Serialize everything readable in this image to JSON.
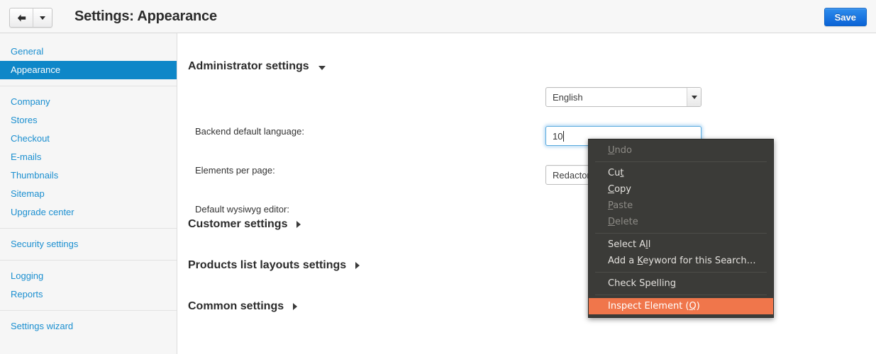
{
  "topbar": {
    "back_icon": "arrow-left-icon",
    "caret_icon": "chevron-down-icon",
    "title": "Settings: Appearance",
    "save_label": "Save",
    "save_color": "#0b63d6"
  },
  "sidebar": {
    "active_color": "#0e87c8",
    "link_color": "#1b8fd0",
    "groups": [
      {
        "items": [
          {
            "label": "General",
            "active": false
          },
          {
            "label": "Appearance",
            "active": true
          }
        ]
      },
      {
        "items": [
          {
            "label": "Company",
            "active": false
          },
          {
            "label": "Stores",
            "active": false
          },
          {
            "label": "Checkout",
            "active": false
          },
          {
            "label": "E-mails",
            "active": false
          },
          {
            "label": "Thumbnails",
            "active": false
          },
          {
            "label": "Sitemap",
            "active": false
          },
          {
            "label": "Upgrade center",
            "active": false
          }
        ]
      },
      {
        "items": [
          {
            "label": "Security settings",
            "active": false
          }
        ]
      },
      {
        "items": [
          {
            "label": "Logging",
            "active": false
          },
          {
            "label": "Reports",
            "active": false
          }
        ]
      },
      {
        "items": [
          {
            "label": "Settings wizard",
            "active": false
          }
        ]
      }
    ]
  },
  "main": {
    "sections": [
      {
        "title": "Administrator settings",
        "expanded": true,
        "icon": "triangle-down-icon"
      },
      {
        "title": "Customer settings",
        "expanded": false,
        "icon": "triangle-right-icon"
      },
      {
        "title": "Products list layouts settings",
        "expanded": false,
        "icon": "triangle-right-icon"
      },
      {
        "title": "Common settings",
        "expanded": false,
        "icon": "triangle-right-icon"
      }
    ],
    "fields": {
      "language": {
        "label": "Backend default language:",
        "value": "English"
      },
      "elements_per_page": {
        "label": "Elements per page:",
        "value": "10",
        "focused": true
      },
      "wysiwyg": {
        "label": "Default wysiwyg editor:",
        "value": "Redactor"
      }
    }
  },
  "context_menu": {
    "highlight_color": "#f0764b",
    "background_color": "#3b3b38",
    "groups": [
      {
        "items": [
          {
            "pre": "",
            "accel": "U",
            "post": "ndo",
            "disabled": true,
            "highlight": false
          }
        ]
      },
      {
        "items": [
          {
            "pre": "Cu",
            "accel": "t",
            "post": "",
            "disabled": false,
            "highlight": false
          },
          {
            "pre": "",
            "accel": "C",
            "post": "opy",
            "disabled": false,
            "highlight": false
          },
          {
            "pre": "",
            "accel": "P",
            "post": "aste",
            "disabled": true,
            "highlight": false
          },
          {
            "pre": "",
            "accel": "D",
            "post": "elete",
            "disabled": true,
            "highlight": false
          }
        ]
      },
      {
        "items": [
          {
            "pre": "Select A",
            "accel": "l",
            "post": "l",
            "disabled": false,
            "highlight": false
          },
          {
            "pre": "Add a ",
            "accel": "K",
            "post": "eyword for this Search…",
            "disabled": false,
            "highlight": false
          }
        ]
      },
      {
        "items": [
          {
            "pre": "Check Spellin",
            "accel": "g",
            "post": "",
            "disabled": false,
            "highlight": false
          }
        ]
      },
      {
        "items": [
          {
            "pre": "Inspect Element (",
            "accel": "Q",
            "post": ")",
            "disabled": false,
            "highlight": true
          }
        ]
      }
    ]
  }
}
